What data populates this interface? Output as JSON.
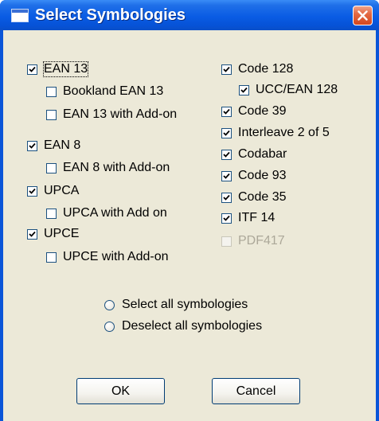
{
  "window": {
    "title": "Select Symbologies"
  },
  "left_column": [
    {
      "label": "EAN 13",
      "checked": true,
      "focused": true,
      "indent": 0
    },
    {
      "label": "Bookland EAN 13",
      "checked": false,
      "indent": 1
    },
    {
      "label": "EAN 13 with Add-on",
      "checked": false,
      "indent": 1
    },
    {
      "label": "EAN 8",
      "checked": true,
      "indent": 0
    },
    {
      "label": "EAN 8 with Add-on",
      "checked": false,
      "indent": 1
    },
    {
      "label": "UPCA",
      "checked": true,
      "indent": 0
    },
    {
      "label": "UPCA with Add on",
      "checked": false,
      "indent": 1
    },
    {
      "label": "UPCE",
      "checked": true,
      "indent": 0
    },
    {
      "label": "UPCE with Add-on",
      "checked": false,
      "indent": 1
    }
  ],
  "right_column": [
    {
      "label": "Code 128",
      "checked": true,
      "indent": 0
    },
    {
      "label": "UCC/EAN 128",
      "checked": true,
      "indent": 1
    },
    {
      "label": "Code 39",
      "checked": true,
      "indent": 0
    },
    {
      "label": "Interleave 2 of 5",
      "checked": true,
      "indent": 0
    },
    {
      "label": "Codabar",
      "checked": true,
      "indent": 0
    },
    {
      "label": "Code 93",
      "checked": true,
      "indent": 0
    },
    {
      "label": "Code 35",
      "checked": true,
      "indent": 0
    },
    {
      "label": "ITF 14",
      "checked": true,
      "indent": 0
    },
    {
      "label": "PDF417",
      "checked": false,
      "disabled": true,
      "indent": 0
    }
  ],
  "radios": {
    "select_all": {
      "label": "Select all symbologies",
      "selected": false
    },
    "deselect_all": {
      "label": "Deselect all symbologies",
      "selected": false
    }
  },
  "buttons": {
    "ok": "OK",
    "cancel": "Cancel"
  },
  "colors": {
    "title_bar": "#0a5ce4",
    "close_button": "#d4471e",
    "dialog_face": "#ece9d8",
    "check_mark": "#000000",
    "disabled_text": "#aca899"
  }
}
